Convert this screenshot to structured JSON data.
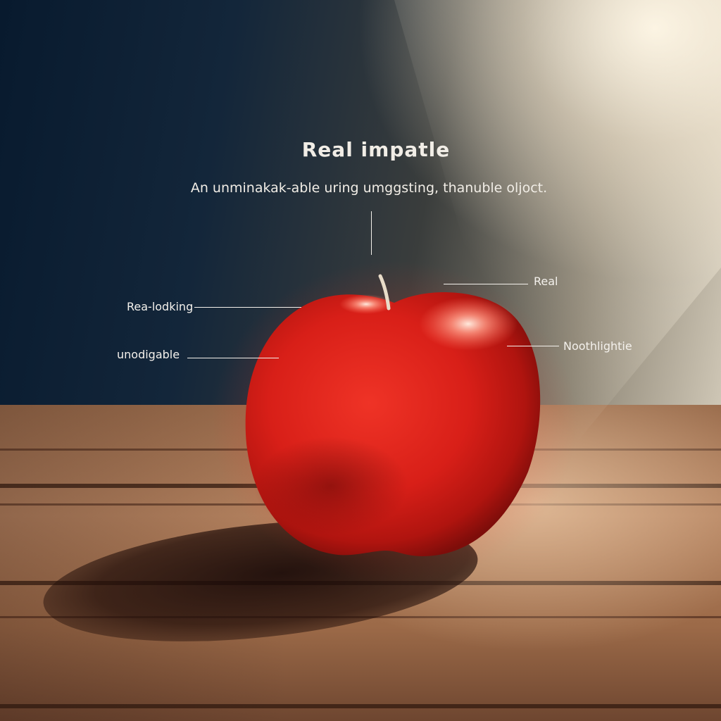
{
  "scene": {
    "description_title": "Real impatle",
    "description_subtitle": "An unminakak-able uring umggsting, thanuble oljoct."
  },
  "callouts": {
    "left_top": "Rea-lodking",
    "left_bottom": "unodigable",
    "right_top": "Real",
    "right_bottom": "Noothlightie"
  },
  "colors": {
    "apple": "#e1231b",
    "apple_highlight": "#ff7a6a",
    "table": "#b4825f",
    "backdrop_dark": "#081a2e",
    "light": "#fff8e8",
    "text": "#f4f1ec"
  }
}
